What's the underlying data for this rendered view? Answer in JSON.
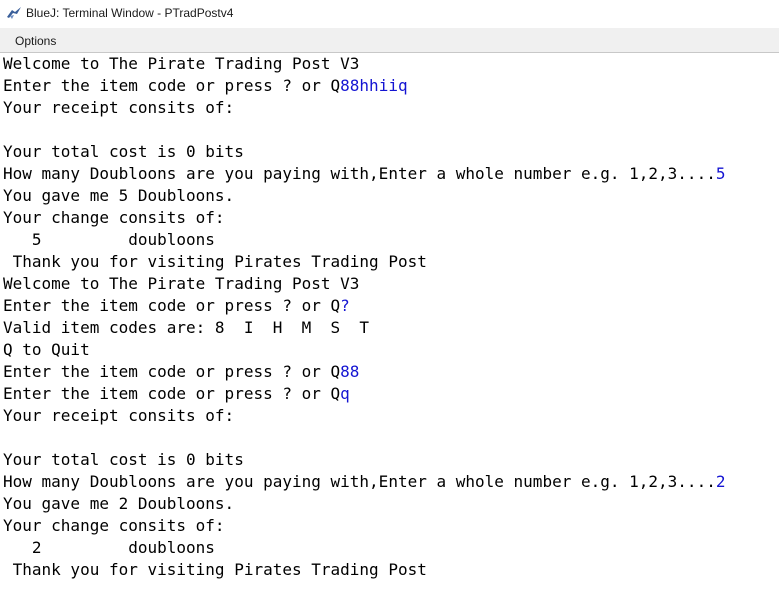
{
  "window": {
    "title": "BlueJ: Terminal Window - PTradPostv4",
    "icon": "bluej-bird-icon"
  },
  "menu": {
    "options_label": "Options"
  },
  "colors": {
    "output_text": "#000000",
    "user_input_text": "#1414d2",
    "menubar_bg": "#f0f0f0"
  },
  "terminal": {
    "lines": [
      {
        "text": "Welcome to The Pirate Trading Post V3",
        "input": ""
      },
      {
        "text": "Enter the item code or press ? or Q",
        "input": "88hhiiq"
      },
      {
        "text": "Your receipt consits of:",
        "input": ""
      },
      {
        "text": "",
        "input": ""
      },
      {
        "text": "Your total cost is 0 bits",
        "input": ""
      },
      {
        "text": "How many Doubloons are you paying with,Enter a whole number e.g. 1,2,3....",
        "input": "5"
      },
      {
        "text": "You gave me 5 Doubloons.",
        "input": ""
      },
      {
        "text": "Your change consits of:",
        "input": ""
      },
      {
        "text": "   5         doubloons",
        "input": ""
      },
      {
        "text": " Thank you for visiting Pirates Trading Post",
        "input": ""
      },
      {
        "text": "Welcome to The Pirate Trading Post V3",
        "input": ""
      },
      {
        "text": "Enter the item code or press ? or Q",
        "input": "?"
      },
      {
        "text": "Valid item codes are: 8  I  H  M  S  T",
        "input": ""
      },
      {
        "text": "Q to Quit",
        "input": ""
      },
      {
        "text": "Enter the item code or press ? or Q",
        "input": "88"
      },
      {
        "text": "Enter the item code or press ? or Q",
        "input": "q"
      },
      {
        "text": "Your receipt consits of:",
        "input": ""
      },
      {
        "text": "",
        "input": ""
      },
      {
        "text": "Your total cost is 0 bits",
        "input": ""
      },
      {
        "text": "How many Doubloons are you paying with,Enter a whole number e.g. 1,2,3....",
        "input": "2"
      },
      {
        "text": "You gave me 2 Doubloons.",
        "input": ""
      },
      {
        "text": "Your change consits of:",
        "input": ""
      },
      {
        "text": "   2         doubloons",
        "input": ""
      },
      {
        "text": " Thank you for visiting Pirates Trading Post",
        "input": ""
      }
    ]
  }
}
